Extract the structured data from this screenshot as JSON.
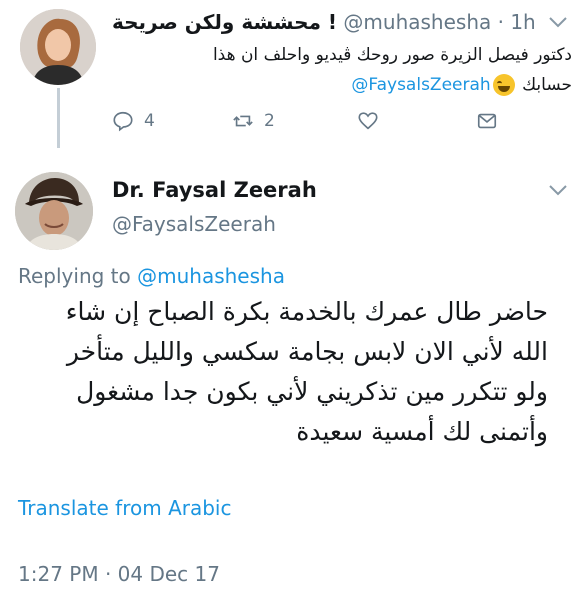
{
  "parent_tweet": {
    "display_name": "محششة ولكن صريحة !",
    "handle": "@muhashesha",
    "time": "· 1h",
    "text_line1": "دكتور فيصل الزيرة صور روحك ڤيديو واحلف ان هذا",
    "text_line2_word": "حسابك",
    "text_mention": "@FaysalsZeerah",
    "emoji_icon": "face-with-tears-of-joy-icon",
    "reply_count": "4",
    "retweet_count": "2"
  },
  "main_tweet": {
    "display_name": "Dr. Faysal Zeerah",
    "handle": "@FaysalsZeerah",
    "replying_prefix": "Replying to",
    "replying_to": "@muhashesha",
    "text_lines": [
      "حاضر طال عمرك بالخدمة بكرة الصباح إن شاء",
      "الله لأني الان لابس بجامة سكسي والليل متأخر",
      "ولو تتكرر مين تذكريني لأني بكون جدا مشغول",
      "وأتمنى لك أمسية سعيدة"
    ],
    "translate_label": "Translate from Arabic",
    "timestamp": "1:27 PM · 04 Dec 17"
  },
  "colors": {
    "link": "#1b95e0",
    "secondary_text": "#657786",
    "primary_text": "#14171a"
  }
}
